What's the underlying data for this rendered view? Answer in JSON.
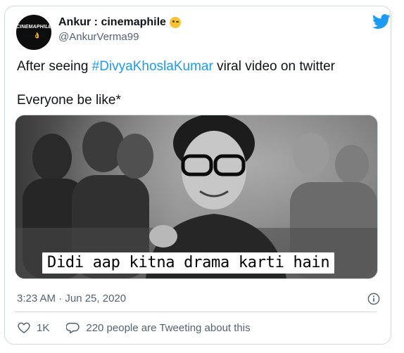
{
  "tweet": {
    "author": {
      "name": "Ankur : cinemaphile",
      "handle": "@AnkurVerma99",
      "avatar_text": "CINEMAPHILE",
      "avatar_emojis": "😂😂👌😂"
    },
    "text": {
      "line1_before": "After seeing ",
      "hashtag": "#DivyaKhoslaKumar",
      "line1_after": " viral video on twitter",
      "line2": "Everyone be like*"
    },
    "media": {
      "caption": "Didi aap kitna drama karti hain"
    },
    "timestamp": "3:23 AM · Jun 25, 2020",
    "likes": "1K",
    "conversation": "220 people are Tweeting about this"
  },
  "icons": {
    "brand": "twitter-bird-icon",
    "emoji": "winking-face-emoji",
    "info": "info-icon",
    "like": "heart-icon",
    "reply": "speech-bubble-icon"
  },
  "colors": {
    "accent": "#1d9bf0",
    "text": "#0f1419",
    "secondary": "#536471",
    "border": "#cfd9de"
  }
}
